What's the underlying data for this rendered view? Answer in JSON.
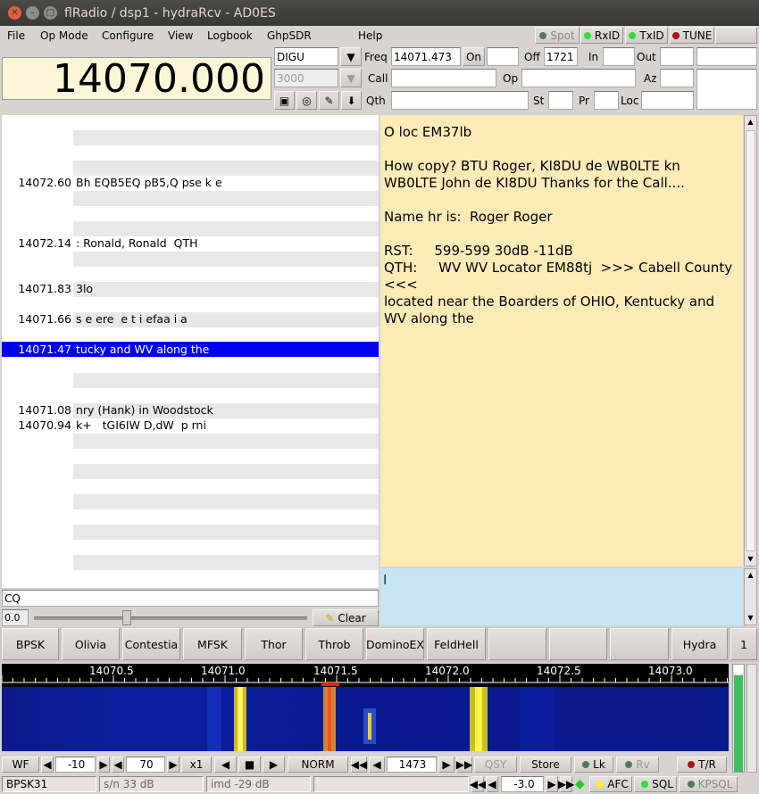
{
  "window": {
    "title": "flRadio /  dsp1 - hydraRcv - AD0ES"
  },
  "menu": [
    "File",
    "Op Mode",
    "Configure",
    "View",
    "Logbook",
    "GhpSDR",
    "Help"
  ],
  "indicators": {
    "spot": "Spot",
    "rxid": "RxID",
    "txid": "TxID",
    "tune": "TUNE"
  },
  "colors": {
    "rx_bg": "#fdebb8",
    "tx_bg": "#c6e6f6",
    "highlight": "#0000f0",
    "led_green": "#33dd33",
    "led_dark": "#557755",
    "led_red": "#aa1111"
  },
  "display_freq": "14070.000",
  "mode": "DIGU",
  "bandwidth": "3000",
  "log": {
    "freq_label": "Freq",
    "freq_value": "14071.473",
    "on_label": "On",
    "off_label": "Off",
    "off_value": "1721",
    "in_label": "In",
    "out_label": "Out",
    "call_label": "Call",
    "op_label": "Op",
    "az_label": "Az",
    "qth_label": "Qth",
    "st_label": "St",
    "pr_label": "Pr",
    "loc_label": "Loc"
  },
  "browser_rows": [
    {
      "freq": "14072.60",
      "text": "Bh EQB5EQ pB5,Q pse k e"
    },
    {
      "freq": "14072.14",
      "text": ": Ronald, Ronald  QTH"
    },
    {
      "freq": "14071.83",
      "text": "3lo"
    },
    {
      "freq": "14071.66",
      "text": "s e ere  e t i efaa i a"
    },
    {
      "freq": "14071.47",
      "text": "tucky and WV along the"
    },
    {
      "freq": "14071.08",
      "text": "nry (Hank) in Woodstock"
    },
    {
      "freq": "14070.94",
      "text": "k+   tGI6IW D,dW  p rni"
    }
  ],
  "search_text": "CQ",
  "squelch_value": "0.0",
  "clear_label": "Clear",
  "rx_text": "O loc EM37lb\n\nHow copy? BTU Roger, KI8DU de WB0LTE kn\nWB0LTE John de KI8DU Thanks for the Call....\n\nName hr is:  Roger Roger\n\nRST:     599-599 30dB -11dB\nQTH:     WV WV Locator EM88tj  >>> Cabell County <<<\nlocated near the Boarders of OHIO, Kentucky and WV along the",
  "mode_buttons": [
    "BPSK",
    "Olivia",
    "Contestia",
    "MFSK",
    "Thor",
    "Throb",
    "DominoEX",
    "FeldHell",
    "",
    "",
    "",
    "Hydra",
    "1"
  ],
  "scale_ticks": [
    "14070.5",
    "14071.0",
    "14071.5",
    "14072.0",
    "14072.5",
    "14073.0"
  ],
  "waterfall_controls": {
    "wf": "WF",
    "offset": "-10",
    "range": "70",
    "zoom": "x1",
    "norm": "NORM",
    "carrier": "1473",
    "qsy": "QSY",
    "store": "Store",
    "lk": "Lk",
    "rv": "Rv",
    "tr": "T/R"
  },
  "status": {
    "mode": "BPSK31",
    "sn": "s/n 33 dB",
    "imd": "imd -29 dB",
    "afc_value": "-3.0",
    "afc": "AFC",
    "sql": "SQL",
    "kpsql": "KPSQL"
  }
}
